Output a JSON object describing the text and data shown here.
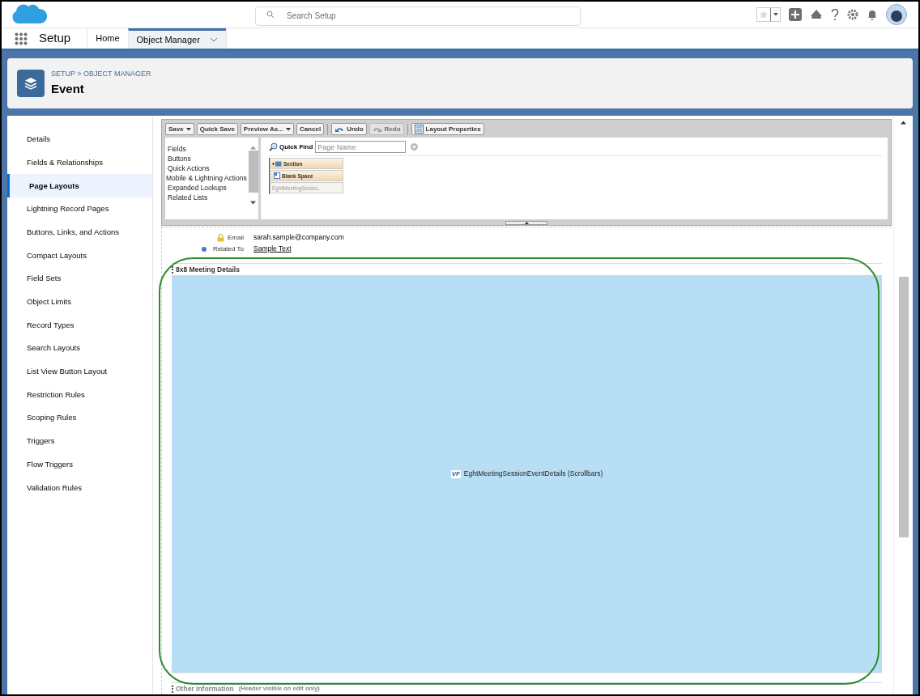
{
  "global_header": {
    "search": {
      "placeholder": "Search Setup"
    }
  },
  "nav": {
    "app_name": "Setup",
    "tabs": [
      {
        "label": "Home",
        "selected": false,
        "dropdown": false
      },
      {
        "label": "Object Manager",
        "selected": true,
        "dropdown": true
      }
    ]
  },
  "page_header": {
    "breadcrumb": "SETUP > OBJECT MANAGER",
    "title": "Event"
  },
  "sidebar": {
    "items": [
      {
        "label": "Details",
        "selected": false
      },
      {
        "label": "Fields & Relationships",
        "selected": false
      },
      {
        "label": "Page Layouts",
        "selected": true
      },
      {
        "label": "Lightning Record Pages",
        "selected": false
      },
      {
        "label": "Buttons, Links, and Actions",
        "selected": false
      },
      {
        "label": "Compact Layouts",
        "selected": false
      },
      {
        "label": "Field Sets",
        "selected": false
      },
      {
        "label": "Object Limits",
        "selected": false
      },
      {
        "label": "Record Types",
        "selected": false
      },
      {
        "label": "Search Layouts",
        "selected": false
      },
      {
        "label": "List View Button Layout",
        "selected": false
      },
      {
        "label": "Restriction Rules",
        "selected": false
      },
      {
        "label": "Scoping Rules",
        "selected": false
      },
      {
        "label": "Triggers",
        "selected": false
      },
      {
        "label": "Flow Triggers",
        "selected": false
      },
      {
        "label": "Validation Rules",
        "selected": false
      }
    ]
  },
  "toolbar": {
    "buttons": [
      {
        "label": "Save",
        "dropdown": true,
        "disabled": false,
        "kind": "plain"
      },
      {
        "label": "Quick Save",
        "dropdown": false,
        "disabled": false,
        "kind": "plain"
      },
      {
        "label": "Preview As...",
        "dropdown": true,
        "disabled": false,
        "kind": "plain"
      },
      {
        "label": "Cancel",
        "dropdown": false,
        "disabled": false,
        "kind": "plain"
      },
      {
        "label": "Undo",
        "dropdown": false,
        "disabled": false,
        "kind": "undo"
      },
      {
        "label": "Redo",
        "dropdown": false,
        "disabled": true,
        "kind": "redo"
      },
      {
        "label": "Layout Properties",
        "dropdown": false,
        "disabled": false,
        "kind": "properties"
      }
    ]
  },
  "palette": {
    "categories": [
      "Fields",
      "Buttons",
      "Quick Actions",
      "Mobile & Lightning Actions",
      "Expanded Lookups",
      "Related Lists"
    ],
    "quick_find": {
      "label": "Quick Find",
      "placeholder": "Page Name"
    },
    "items": [
      {
        "label": "Section",
        "disabled": false,
        "kind": "section"
      },
      {
        "label": "Blank Space",
        "disabled": false,
        "kind": "blank"
      },
      {
        "label": "EghtMeetingSessio...",
        "disabled": true,
        "kind": "page"
      }
    ]
  },
  "fields": [
    {
      "label": "Email",
      "value": "sarah.sample@company.com",
      "kind": "locked",
      "link": false
    },
    {
      "label": "Related To",
      "value": "Sample Text",
      "kind": "required",
      "link": true
    }
  ],
  "sections": [
    {
      "title": "8x8 Meeting Details",
      "visualforce": {
        "badge": "VF",
        "label": "EghtMeetingSessionEventDetails (Scrollbars)"
      }
    },
    {
      "title": "Other Information",
      "note": "(Header visible on edit only)"
    }
  ]
}
